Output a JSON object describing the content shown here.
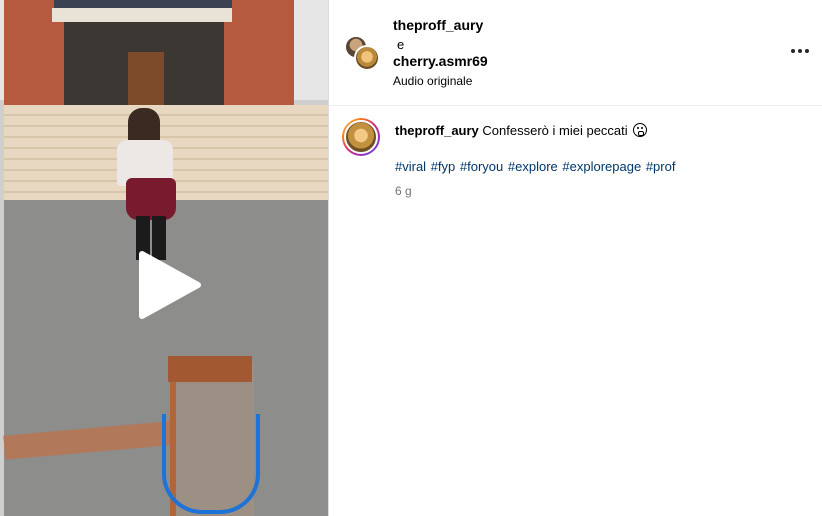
{
  "header": {
    "user1": "theproff_aury",
    "and": "e",
    "user2": "cherry.asmr69",
    "audio": "Audio originale"
  },
  "caption": {
    "username": "theproff_aury",
    "text": "Confesserò i miei peccati",
    "emoji": "sleeping-face-emoji",
    "hashtags": [
      "#viral",
      "#fyp",
      "#foryou",
      "#explore",
      "#explorepage",
      "#prof"
    ],
    "time": "6 g"
  },
  "icons": {
    "more": "more-options-icon",
    "play": "play-icon"
  },
  "colors": {
    "hashtag": "#00376b",
    "muted": "#737373",
    "story_ring": [
      "#feda75",
      "#fa7e1e",
      "#d62976",
      "#962fbf",
      "#4f5bd5"
    ]
  }
}
